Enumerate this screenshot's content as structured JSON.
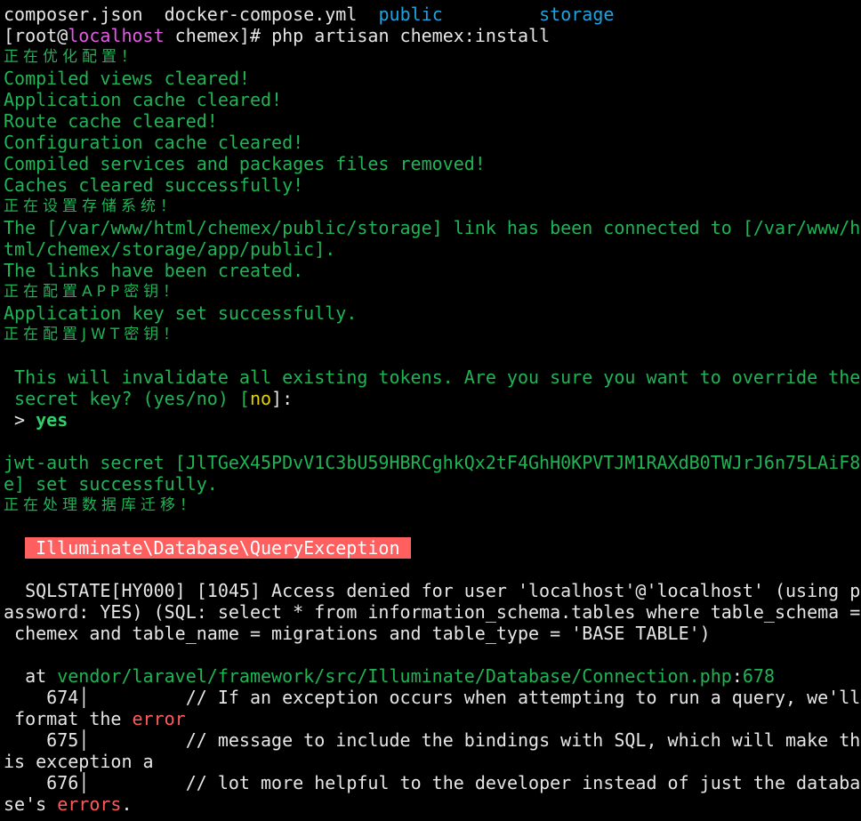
{
  "terminal": {
    "ls_output": {
      "file1": "composer.json",
      "file2": "docker-compose.yml",
      "dir1": "public",
      "dir2": "storage"
    },
    "prompt": {
      "open": "[",
      "user": "root",
      "at": "@",
      "host": "localhost",
      "cwd": " chemex]# ",
      "command": "php artisan chemex:install"
    },
    "steps": {
      "optimize": "正在优化配置！",
      "views_cleared": "Compiled views cleared!",
      "app_cache": "Application cache cleared!",
      "route_cache": "Route cache cleared!",
      "config_cache": "Configuration cache cleared!",
      "services_removed": "Compiled services and packages files removed!",
      "caches_cleared": "Caches cleared successfully!",
      "storage_setup": "正在设置存储系统！",
      "link_line1": "The [/var/www/html/chemex/public/storage] link has been connected to [/var/www/h",
      "link_line2": "tml/chemex/storage/app/public].",
      "links_created": "The links have been created.",
      "app_key": "正在配置APP密钥！",
      "app_key_set": "Application key set successfully.",
      "jwt_key": "正在配置JWT密钥！"
    },
    "question": {
      "line1": " This will invalidate all existing tokens. Are you sure you want to override the",
      "line2_prefix": " secret key? (yes/no) [",
      "default": "no",
      "line2_suffix": "]:",
      "answer_prefix": " > ",
      "answer": "yes"
    },
    "jwt": {
      "line1": "jwt-auth secret [JlTGeX45PDvV1C3bU59HBRCghkQx2tF4GhH0KPVTJM1RAXdB0TWJrJ6n75LAiF8",
      "line2": "e] set successfully.",
      "migrate": "正在处理数据库迁移！"
    },
    "exception": {
      "title": "Illuminate\\Database\\QueryException",
      "msg1": "  SQLSTATE[HY000] [1045] Access denied for user 'localhost'@'localhost' (using p",
      "msg2": "assword: YES) (SQL: select * from information_schema.tables where table_schema =",
      "msg3": " chemex and table_name = migrations and table_type = 'BASE TABLE')",
      "at_label": "  at ",
      "path": "vendor/laravel/framework/src/Illuminate/Database/Connection.php",
      "colon": ":",
      "line_no": "678"
    },
    "code": {
      "l674_no": "    674",
      "l674_text": "         // If an exception occurs when attempting to run a query, we'll",
      "l674_cont_prefix": " format the ",
      "l674_cont_err": "error",
      "l675_no": "    675",
      "l675_text": "         // message to include the bindings with SQL, which will make th",
      "l675_cont": "is exception a",
      "l676_no": "    676",
      "l676_text": "         // lot more helpful to the developer instead of just the databa",
      "l676_cont_prefix": "se's ",
      "l676_cont_err": "errors",
      "l676_cont_suffix": ".",
      "pipe": "│"
    }
  }
}
